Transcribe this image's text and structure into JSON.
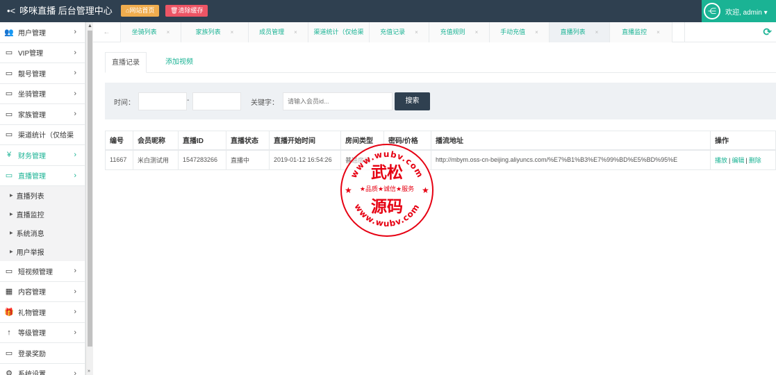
{
  "header": {
    "brand_title": "哆咪直播 后台管理中心",
    "home_button": "网站首页",
    "clear_cache_button": "清除缓存",
    "welcome": "欢迎, admin ▾"
  },
  "sidebar": {
    "items": [
      {
        "label": "用户管理",
        "icon": "users-icon"
      },
      {
        "label": "VIP管理",
        "icon": "monitor-icon"
      },
      {
        "label": "靓号管理",
        "icon": "monitor-icon"
      },
      {
        "label": "坐骑管理",
        "icon": "monitor-icon"
      },
      {
        "label": "家族管理",
        "icon": "monitor-icon"
      },
      {
        "label": "渠道统计（仅给渠",
        "icon": "monitor-icon"
      },
      {
        "label": "财务管理",
        "icon": "yen-icon"
      },
      {
        "label": "直播管理",
        "icon": "monitor-icon"
      }
    ],
    "sub_items": [
      "直播列表",
      "直播监控",
      "系统消息",
      "用户举报"
    ],
    "items_after": [
      {
        "label": "短视频管理",
        "icon": "monitor-icon"
      },
      {
        "label": "内容管理",
        "icon": "grid-icon"
      },
      {
        "label": "礼物管理",
        "icon": "gift-icon"
      },
      {
        "label": "等级管理",
        "icon": "level-icon"
      },
      {
        "label": "登录奖励",
        "icon": "monitor-icon"
      },
      {
        "label": "系统设置",
        "icon": "gears-icon"
      }
    ]
  },
  "tabs": [
    {
      "label": "坐骑列表"
    },
    {
      "label": "家族列表"
    },
    {
      "label": "成员管理"
    },
    {
      "label": "渠道统计（仅给渠"
    },
    {
      "label": "充值记录"
    },
    {
      "label": "充值规则"
    },
    {
      "label": "手动充值"
    },
    {
      "label": "直播列表"
    },
    {
      "label": "直播监控"
    }
  ],
  "page": {
    "subtab_active": "直播记录",
    "subtab_add": "添加视频",
    "search": {
      "time_label": "时间：",
      "dash": "-",
      "keyword_label": "关键字：",
      "keyword_placeholder": "请输入会员id...",
      "button": "搜索"
    },
    "table": {
      "headers": [
        "编号",
        "会员昵称",
        "直播ID",
        "直播状态",
        "直播开始时间",
        "房间类型",
        "密码/价格",
        "播流地址",
        "操作"
      ],
      "rows": [
        {
          "id": "11667",
          "nickname": "米白测试用",
          "live_id": "1547283266",
          "status": "直播中",
          "start_time": "2019-01-12 16:54:26",
          "room_type": "普通房间",
          "password_price": "",
          "stream_url": "http://mbym.oss-cn-beijing.aliyuncs.com/%E7%B1%B3%E7%99%BD%E5%BD%95%E",
          "actions": {
            "play": "播放",
            "edit": "编辑",
            "delete": "删除",
            "sep": "|"
          }
        }
      ]
    }
  },
  "watermark": {
    "url_text": "www.wubv.com",
    "main_top": "武松",
    "main_bottom": "源码",
    "slogan": "★品质★诚信★服务",
    "color": "#e60012"
  }
}
